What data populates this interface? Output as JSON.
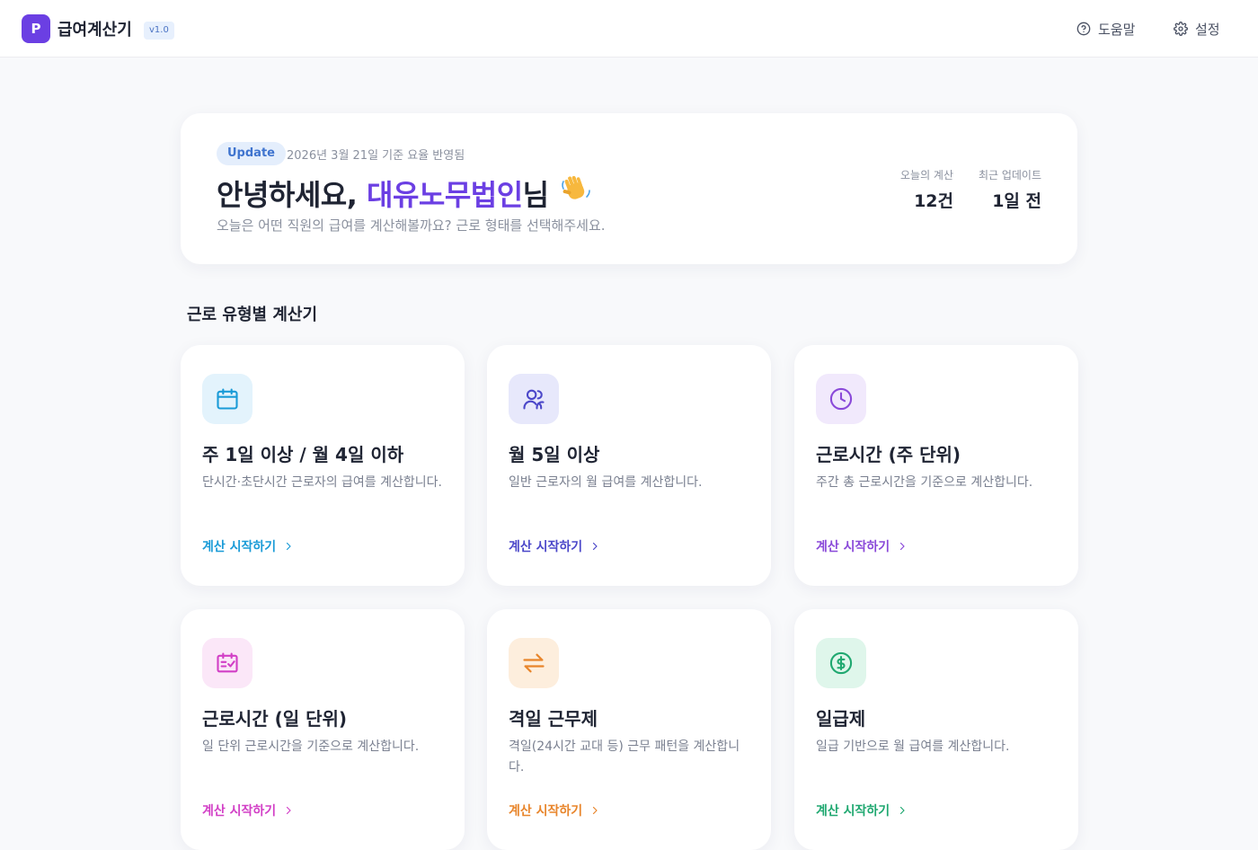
{
  "header": {
    "logo_letter": "P",
    "app_title": "급여계산기",
    "version": "v1.0",
    "nav": [
      {
        "label": "도움말",
        "icon": "help-circle-icon"
      },
      {
        "label": "설정",
        "icon": "gear-icon"
      }
    ]
  },
  "hero": {
    "badge": "Update",
    "update_note": "2026년 3월 21일 기준 요율 반영됨",
    "greeting_prefix": "안녕하세요, ",
    "org_name": "대유노무법인",
    "greeting_suffix": "님",
    "wave_icon": "waving-hand-icon",
    "subtitle": "오늘은 어떤 직원의 급여를 계산해볼까요? 근로 형태를 선택해주세요.",
    "stats": [
      {
        "label": "오늘의 계산",
        "value": "12건"
      },
      {
        "label": "최근 업데이트",
        "value": "1일 전"
      }
    ]
  },
  "section_title": "근로 유형별 계산기",
  "cards": [
    {
      "title": "주 1일 이상 / 월 4일 이하",
      "description": "단시간·초단시간 근로자의 급여를 계산합니다.",
      "link": "계산 시작하기",
      "icon": "calendar-icon",
      "accent": "#1a9bd7",
      "icon_bg": "#e3f3fc"
    },
    {
      "title": "월 5일 이상",
      "description": "일반 근로자의 월 급여를 계산합니다.",
      "link": "계산 시작하기",
      "icon": "users-icon",
      "accent": "#4b47c9",
      "icon_bg": "#e7e8fb"
    },
    {
      "title": "근로시간 (주 단위)",
      "description": "주간 총 근로시간을 기준으로 계산합니다.",
      "link": "계산 시작하기",
      "icon": "clock-icon",
      "accent": "#8a49d9",
      "icon_bg": "#f1e9fc"
    },
    {
      "title": "근로시간 (일 단위)",
      "description": "일 단위 근로시간을 기준으로 계산합니다.",
      "link": "계산 시작하기",
      "icon": "calendar-check-icon",
      "accent": "#d23fc6",
      "icon_bg": "#fbe7f8"
    },
    {
      "title": "격일 근무제",
      "description": "격일(24시간 교대 등) 근무 패턴을 계산합니다.",
      "link": "계산 시작하기",
      "icon": "swap-arrows-icon",
      "accent": "#e8852b",
      "icon_bg": "#fdeedd"
    },
    {
      "title": "일급제",
      "description": "일급 기반으로 월 급여를 계산합니다.",
      "link": "계산 시작하기",
      "icon": "dollar-circle-icon",
      "accent": "#1fa870",
      "icon_bg": "#dff6eb"
    }
  ]
}
